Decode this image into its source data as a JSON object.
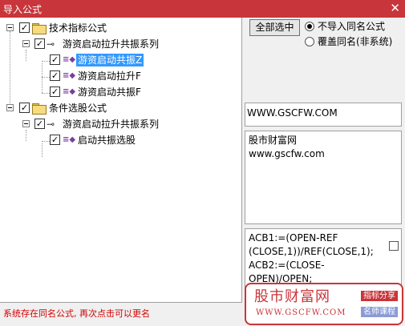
{
  "window": {
    "title": "导入公式",
    "close_glyph": "✕"
  },
  "tree": {
    "nodes": [
      {
        "label": "技术指标公式",
        "checked": "✓"
      },
      {
        "label": "游资启动拉升共振系列",
        "checked": "✓"
      },
      {
        "label": "游资启动共振Z",
        "checked": "✓"
      },
      {
        "label": "游资启动拉升F",
        "checked": "✓"
      },
      {
        "label": "游资启动共振F",
        "checked": "✓"
      },
      {
        "label": "条件选股公式",
        "checked": "✓"
      },
      {
        "label": "游资启动拉升共振系列",
        "checked": "✓"
      },
      {
        "label": "启动共振选股",
        "checked": "✓"
      }
    ]
  },
  "options": {
    "select_all_label": "全部选中",
    "radio_skip_label": "不导入同名公式",
    "radio_overwrite_label": "覆盖同名(非系统)"
  },
  "info": {
    "url_box": "WWW.GSCFW.COM",
    "desc_line1": "股市财富网",
    "desc_line2": "www.gscfw.com",
    "code_line1": "ACB1:=(OPEN-REF",
    "code_line2": "(CLOSE,1))/REF(CLOSE,1);",
    "code_line3": "ACB2:=(CLOSE-",
    "code_line4": "OPEN)/OPEN;"
  },
  "watermark": {
    "brand": "股市财富网",
    "url": "WWW.GSCFW.COM",
    "tag1": "指标分享",
    "tag2": "名师课程"
  },
  "status": {
    "message": "系统存在同名公式, 再次点击可以更名"
  }
}
